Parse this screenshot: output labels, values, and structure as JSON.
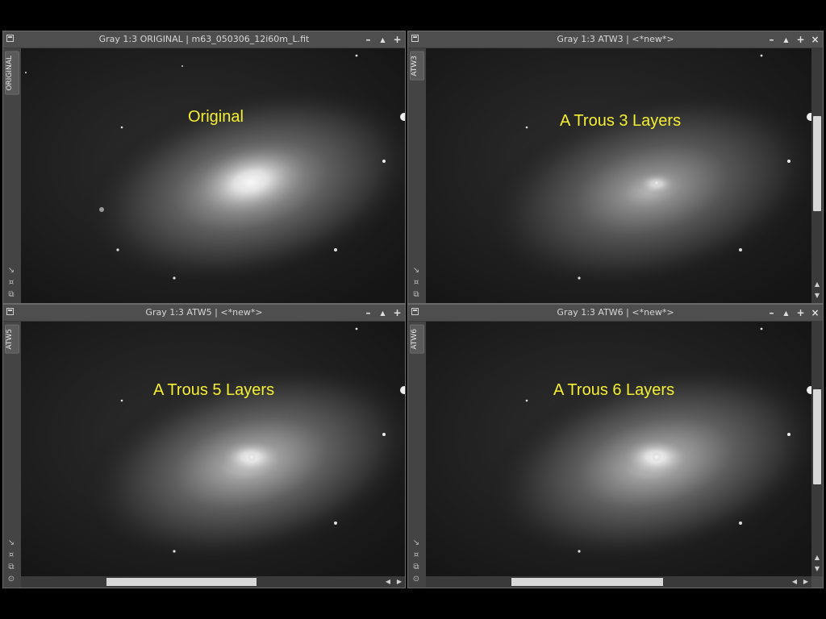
{
  "windows": {
    "w1": {
      "title": "Gray 1:3 ORIGINAL | m63_050306_12i60m_L.fit",
      "tab": "ORIGINAL",
      "caption": "Original"
    },
    "w2": {
      "title": "Gray 1:3 ATW3 | <*new*>",
      "tab": "ATW3",
      "caption": "A Trous 3 Layers"
    },
    "w3": {
      "title": "Gray 1:3 ATW5 | <*new*>",
      "tab": "ATW5",
      "caption": "A Trous 5 Layers"
    },
    "w4": {
      "title": "Gray 1:3 ATW6 | <*new*>",
      "tab": "ATW6",
      "caption": "A Trous 6 Layers"
    }
  },
  "buttons": {
    "minimize": "–",
    "shade": "▲",
    "maximize": "+",
    "close": "×"
  },
  "icons": [
    "window-icon",
    "minimize-icon",
    "shade-icon",
    "maximize-icon",
    "close-icon",
    "zoom-fit-icon",
    "pan-icon",
    "link-icon",
    "nav-icon"
  ],
  "colors": {
    "caption": "#f4f030",
    "background": "#000000",
    "frame": "#4a4a4a"
  }
}
